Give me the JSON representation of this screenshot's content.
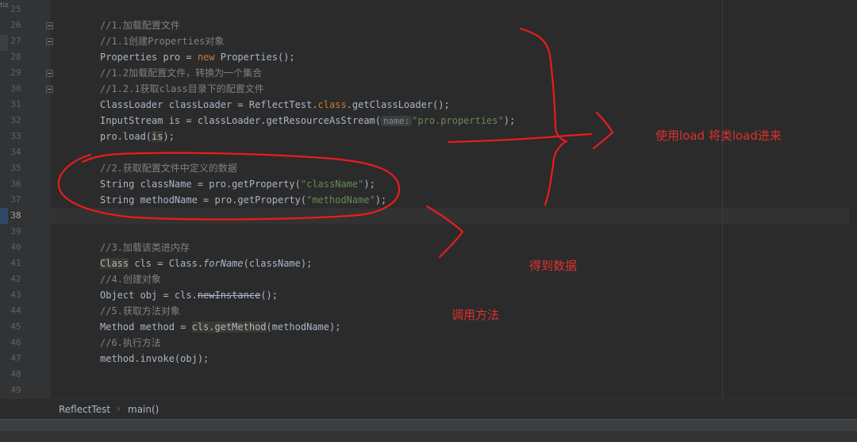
{
  "editor": {
    "corner_glyph": "tiƨ",
    "gutter_lines": [
      "25",
      "26",
      "27",
      "28",
      "29",
      "30",
      "31",
      "32",
      "33",
      "34",
      "35",
      "36",
      "37",
      "38",
      "39",
      "40",
      "41",
      "42",
      "43",
      "44",
      "45",
      "46",
      "47",
      "48",
      "49"
    ],
    "current_line": "38",
    "code": {
      "l26": "//1.加载配置文件",
      "l27": "//1.1创建Properties对象",
      "l28_a": "Properties pro = ",
      "l28_kw": "new",
      "l28_b": " Properties();",
      "l29": "//1.2加载配置文件，转换为一个集合",
      "l30": "//1.2.1获取class目录下的配置文件",
      "l31_a": "ClassLoader classLoader = ReflectTest.",
      "l31_kw": "class",
      "l31_b": ".getClassLoader();",
      "l32_a": "InputStream is = classLoader.getResourceAsStream(",
      "l32_hint": "name:",
      "l32_str": "\"pro.properties\"",
      "l32_b": ");",
      "l33_a": "pro.load(",
      "l33_hl": "is",
      "l33_b": ");",
      "l35": "//2.获取配置文件中定义的数据",
      "l36_a": "String className = pro.getProperty(",
      "l36_str": "\"className\"",
      "l36_b": ");",
      "l37_a": "String methodName = pro.getProperty(",
      "l37_str": "\"methodName\"",
      "l37_b": ");",
      "l40": "//3.加载该类进内存",
      "l41_hl": "Class",
      "l41_a": " cls = Class.",
      "l41_it": "forName",
      "l41_b": "(className);",
      "l42": "//4.创建对象",
      "l43_a": "Object obj = cls.",
      "l43_strike": "newInstance",
      "l43_b": "();",
      "l44": "//5.获取方法对象",
      "l45_a": "Method method = ",
      "l45_hl": "cls.getMethod",
      "l45_b": "(methodName);",
      "l46": "//6.执行方法",
      "l47": "method.invoke(obj);"
    }
  },
  "annotations": {
    "load": "使用load  将类load进来",
    "get_data": "得到数据",
    "call_method": "调用方法"
  },
  "breadcrumb": {
    "class_name": "ReflectTest",
    "separator": "›",
    "method_name": "main()"
  },
  "colors": {
    "background": "#2b2b2b",
    "comment": "#808080",
    "keyword": "#cc7832",
    "string": "#6a8759",
    "identifier": "#a9b7c6",
    "annotation_ink": "#ea1c1c"
  }
}
